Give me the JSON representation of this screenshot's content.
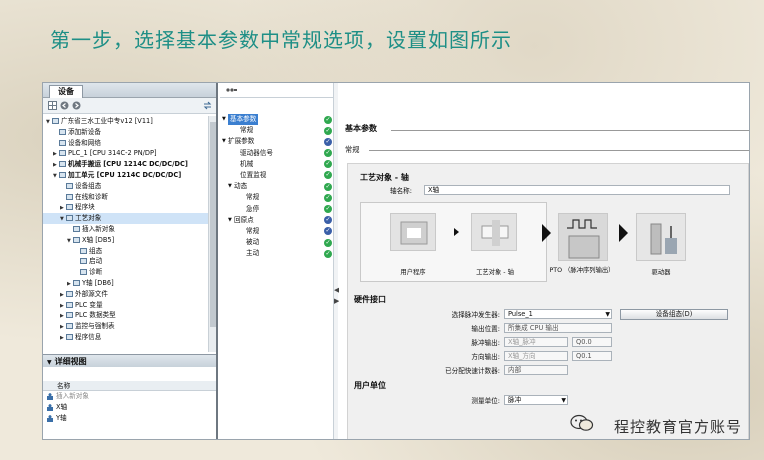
{
  "slide": {
    "title": "第一步，选择基本参数中常规选项，设置如图所示",
    "watermark": "程控教育官方账号"
  },
  "left_panel": {
    "tab": "设备",
    "tree": [
      {
        "label": "广东省三水工业中专v12 [V11]",
        "arrow": "▼",
        "indent": 0,
        "icon": true
      },
      {
        "label": "添加新设备",
        "arrow": "",
        "indent": 1,
        "icon": true
      },
      {
        "label": "设备和网络",
        "arrow": "",
        "indent": 1,
        "icon": true
      },
      {
        "label": "PLC_1 [CPU 314C-2 PN/DP]",
        "arrow": "▶",
        "indent": 1,
        "icon": true
      },
      {
        "label": "机械手搬运 [CPU 1214C DC/DC/DC]",
        "arrow": "▶",
        "indent": 1,
        "icon": true,
        "bold": true
      },
      {
        "label": "加工单元 [CPU 1214C DC/DC/DC]",
        "arrow": "▼",
        "indent": 1,
        "icon": true,
        "bold": true
      },
      {
        "label": "设备组态",
        "arrow": "",
        "indent": 2,
        "icon": true
      },
      {
        "label": "在线和诊断",
        "arrow": "",
        "indent": 2,
        "icon": true
      },
      {
        "label": "程序块",
        "arrow": "▶",
        "indent": 2,
        "icon": true
      },
      {
        "label": "工艺对象",
        "arrow": "▼",
        "indent": 2,
        "icon": true,
        "sel": true
      },
      {
        "label": "插入新对象",
        "arrow": "",
        "indent": 3,
        "icon": true
      },
      {
        "label": "X轴 [DB5]",
        "arrow": "▼",
        "indent": 3,
        "icon": true
      },
      {
        "label": "组态",
        "arrow": "",
        "indent": 4,
        "icon": true
      },
      {
        "label": "启动",
        "arrow": "",
        "indent": 4,
        "icon": true
      },
      {
        "label": "诊断",
        "arrow": "",
        "indent": 4,
        "icon": true
      },
      {
        "label": "Y轴 [DB6]",
        "arrow": "▶",
        "indent": 3,
        "icon": true
      },
      {
        "label": "外部源文件",
        "arrow": "▶",
        "indent": 2,
        "icon": true
      },
      {
        "label": "PLC 变量",
        "arrow": "▶",
        "indent": 2,
        "icon": true
      },
      {
        "label": "PLC 数据类型",
        "arrow": "▶",
        "indent": 2,
        "icon": true
      },
      {
        "label": "监控与强制表",
        "arrow": "▶",
        "indent": 2,
        "icon": true
      },
      {
        "label": "程序信息",
        "arrow": "▶",
        "indent": 2,
        "icon": true
      }
    ],
    "detail_view": {
      "title": "详细视图",
      "column": "名称",
      "rows": [
        {
          "label": "插入新对象",
          "muted": true
        },
        {
          "label": "X轴",
          "muted": false
        },
        {
          "label": "Y轴",
          "muted": false
        }
      ]
    }
  },
  "nav": {
    "items": [
      {
        "label": "基本参数",
        "indent": 0,
        "arrow": "▼",
        "check": "green",
        "sel": true
      },
      {
        "label": "常规",
        "indent": 2,
        "arrow": "",
        "check": "green"
      },
      {
        "label": "扩展参数",
        "indent": 0,
        "arrow": "▼",
        "check": "blue"
      },
      {
        "label": "驱动器信号",
        "indent": 2,
        "arrow": "",
        "check": "green"
      },
      {
        "label": "机械",
        "indent": 2,
        "arrow": "",
        "check": "green"
      },
      {
        "label": "位置监视",
        "indent": 2,
        "arrow": "",
        "check": "green"
      },
      {
        "label": "动态",
        "indent": 1,
        "arrow": "▼",
        "check": "green"
      },
      {
        "label": "常规",
        "indent": 3,
        "arrow": "",
        "check": "green"
      },
      {
        "label": "急停",
        "indent": 3,
        "arrow": "",
        "check": "green"
      },
      {
        "label": "回原点",
        "indent": 1,
        "arrow": "▼",
        "check": "blue"
      },
      {
        "label": "常规",
        "indent": 3,
        "arrow": "",
        "check": "blue"
      },
      {
        "label": "被动",
        "indent": 3,
        "arrow": "",
        "check": "green"
      },
      {
        "label": "主动",
        "indent": 3,
        "arrow": "",
        "check": "green"
      }
    ]
  },
  "content": {
    "section_basic": "基本参数",
    "section_general": "常规",
    "tech_object_title": "工艺对象 - 轴",
    "axis_name_label": "轴名称:",
    "axis_name_value": "X轴",
    "flow": {
      "user_program": "用户程序",
      "tech_object": "工艺对象 - 轴",
      "pto": "PTO （脉冲序列输出）",
      "drive": "驱动器"
    },
    "hardware": {
      "title": "硬件接口",
      "pulse_gen_label": "选择脉冲发生器:",
      "pulse_gen_value": "Pulse_1",
      "config_button": "设备组态(D)",
      "output_pos_label": "输出位置:",
      "output_pos_value": "所集成 CPU 输出",
      "pulse_out_label": "脉冲输出:",
      "pulse_out_value": "X轴_脉冲",
      "pulse_out_addr": "Q0.0",
      "dir_out_label": "方向输出:",
      "dir_out_value": "X轴_方向",
      "dir_out_addr": "Q0.1",
      "hsc_label": "已分配快速计数器:",
      "hsc_value": "内部"
    },
    "units": {
      "title": "用户单位",
      "measure_label": "测量单位:",
      "measure_value": "脉冲"
    }
  },
  "colors": {
    "title_teal": "#1e8f86",
    "check_green": "#2fa84f",
    "check_blue": "#3a5fa8",
    "selection": "#3b7fd0"
  }
}
